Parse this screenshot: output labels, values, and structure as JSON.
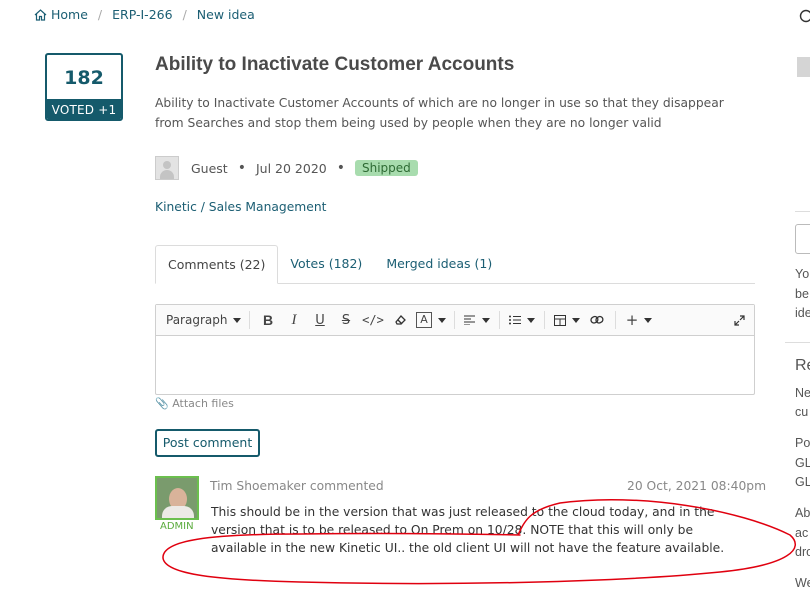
{
  "breadcrumb": {
    "home": "Home",
    "project": "ERP-I-266",
    "current": "New idea"
  },
  "vote": {
    "count": "182",
    "button_label": "VOTED +1"
  },
  "idea": {
    "title": "Ability to Inactivate Customer Accounts",
    "description": "Ability to Inactivate Customer Accounts of which are no longer in use so that they disappear from Searches and stop them being used by people when they are no longer valid",
    "author": "Guest",
    "date": "Jul 20 2020",
    "status": "Shipped",
    "category": "Kinetic / Sales Management"
  },
  "tabs": [
    "Comments (22)",
    "Votes (182)",
    "Merged ideas (1)"
  ],
  "editor": {
    "paragraph_label": "Paragraph",
    "attach_label": "Attach files",
    "post_label": "Post comment"
  },
  "comment": {
    "author": "Tim Shoemaker commented",
    "role": "ADMIN",
    "date": "20 Oct, 2021 08:40pm",
    "text": "This should be in the version that was just released to the cloud today, and in the version that is to be released to On Prem on 10/28. NOTE that this will only be available in the new Kinetic UI.. the old client UI will not have the feature available."
  },
  "sidebar_fragments": {
    "f1": "Yo",
    "f2": "be",
    "f3": "ide",
    "f4": "Re",
    "f5": "Ne",
    "f6": "cu",
    "f7": "Po",
    "f8": "GL",
    "f9": "GL",
    "f10": "Ab",
    "f11": "ac",
    "f12": "dro",
    "f13": "We"
  },
  "colors": {
    "accent": "#155a6b",
    "link": "#1b5e73",
    "status_bg": "#a8dcae",
    "annotation": "#e0000f"
  }
}
